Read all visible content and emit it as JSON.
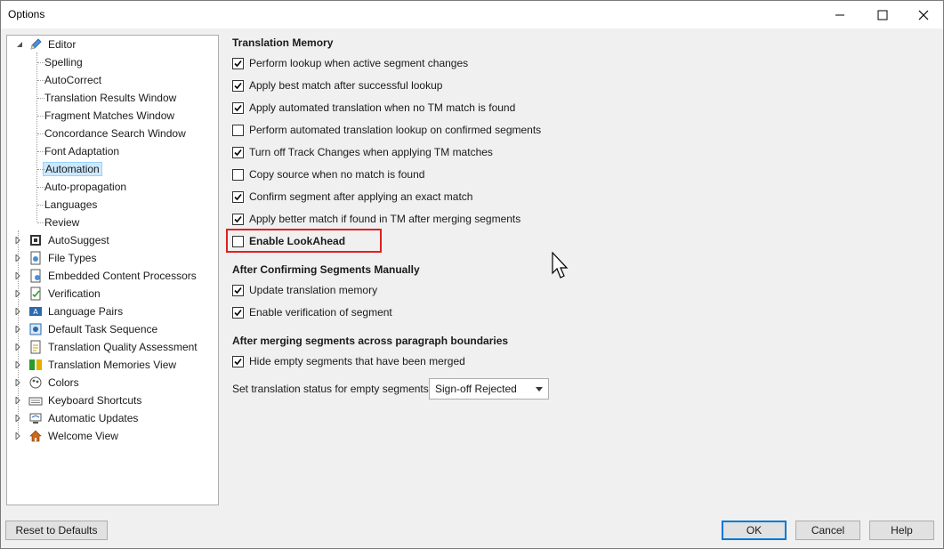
{
  "window": {
    "title": "Options"
  },
  "tree": {
    "editor": {
      "label": "Editor",
      "children": [
        "Spelling",
        "AutoCorrect",
        "Translation Results Window",
        "Fragment Matches Window",
        "Concordance Search Window",
        "Font Adaptation",
        "Automation",
        "Auto-propagation",
        "Languages",
        "Review"
      ],
      "selected_index": 6
    },
    "items": [
      {
        "label": "AutoSuggest",
        "icon": "autosuggest-icon"
      },
      {
        "label": "File Types",
        "icon": "file-types-icon"
      },
      {
        "label": "Embedded Content Processors",
        "icon": "embedded-content-icon"
      },
      {
        "label": "Verification",
        "icon": "verification-icon"
      },
      {
        "label": "Language Pairs",
        "icon": "language-pairs-icon"
      },
      {
        "label": "Default Task Sequence",
        "icon": "task-sequence-icon"
      },
      {
        "label": "Translation Quality Assessment",
        "icon": "tqa-icon"
      },
      {
        "label": "Translation Memories View",
        "icon": "tm-view-icon"
      },
      {
        "label": "Colors",
        "icon": "colors-icon"
      },
      {
        "label": "Keyboard Shortcuts",
        "icon": "keyboard-icon"
      },
      {
        "label": "Automatic Updates",
        "icon": "updates-icon"
      },
      {
        "label": "Welcome View",
        "icon": "home-icon"
      }
    ]
  },
  "translation_memory": {
    "title": "Translation Memory",
    "options": [
      {
        "label": "Perform lookup when active segment changes",
        "checked": true
      },
      {
        "label": "Apply best match after successful lookup",
        "checked": true
      },
      {
        "label": "Apply automated translation when no TM match is found",
        "checked": true
      },
      {
        "label": "Perform automated translation lookup on confirmed segments",
        "checked": false
      },
      {
        "label": "Turn off Track Changes when applying TM matches",
        "checked": true
      },
      {
        "label": "Copy source when no match is found",
        "checked": false
      },
      {
        "label": "Confirm segment after applying an exact match",
        "checked": true
      },
      {
        "label": "Apply better match if found in TM after merging segments",
        "checked": true
      },
      {
        "label": "Enable LookAhead",
        "checked": false
      }
    ]
  },
  "after_confirming": {
    "title": "After Confirming Segments Manually",
    "options": [
      {
        "label": "Update translation memory",
        "checked": true
      },
      {
        "label": "Enable verification of segment",
        "checked": true
      }
    ]
  },
  "after_merging": {
    "title": "After merging segments across paragraph boundaries",
    "options": [
      {
        "label": "Hide empty segments that have been merged",
        "checked": true
      }
    ],
    "status_label": "Set translation status for empty segments to:",
    "status_value": "Sign-off Rejected"
  },
  "buttons": {
    "reset": "Reset to Defaults",
    "ok": "OK",
    "cancel": "Cancel",
    "help": "Help"
  },
  "colors": {
    "highlight": "#e02020",
    "selection": "#cce8ff",
    "primary_border": "#0078d7"
  }
}
